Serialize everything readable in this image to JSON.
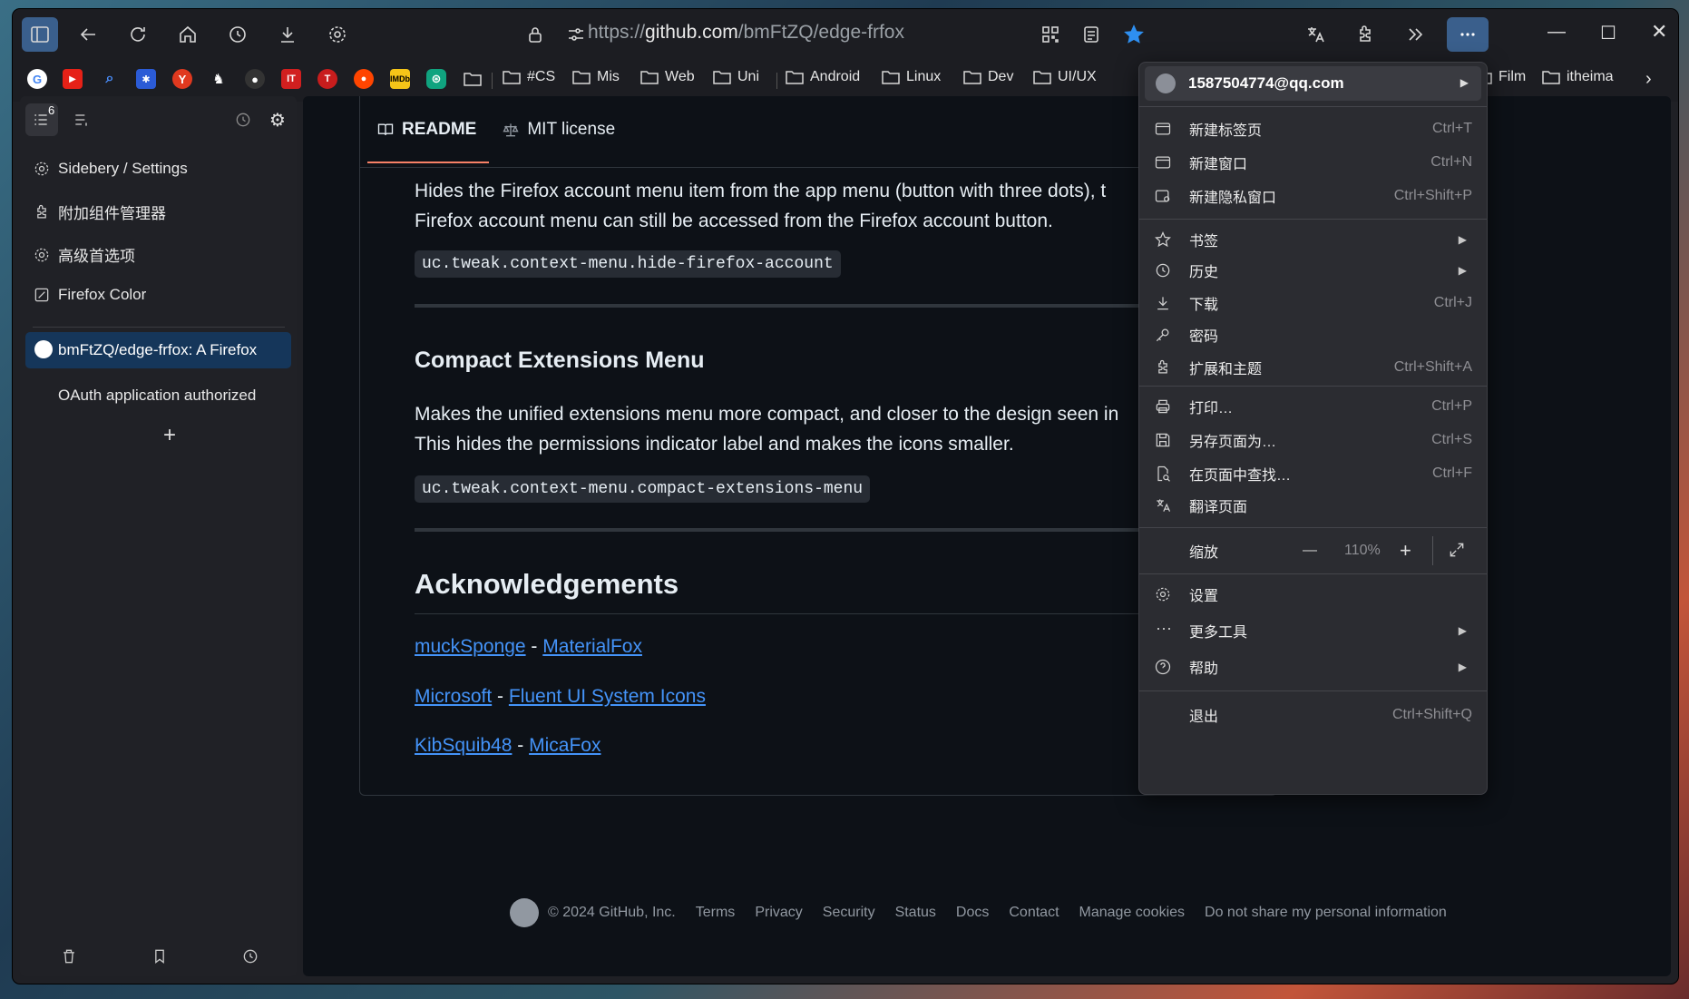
{
  "toolbar": {
    "url_prefix": "https://",
    "url_host": "github.com",
    "url_path": "/bmFtZQ/edge-frfox"
  },
  "bookmarks": {
    "folders": [
      "#CS",
      "Mis",
      "Web",
      "Uni",
      "Android",
      "Linux",
      "Dev",
      "UI/UX",
      "Film",
      "itheima"
    ],
    "icons": [
      "google-icon",
      "youtube-icon",
      "search-icon",
      "baidu-icon",
      "yandex-icon",
      "fox-icon",
      "github-icon",
      "ithome-icon",
      "t-icon",
      "reddit-icon",
      "imdb-icon",
      "chatgpt-icon"
    ]
  },
  "sidebar": {
    "tab_count": "6",
    "items": [
      "Sidebery / Settings",
      "附加组件管理器",
      "高级首选项",
      "Firefox Color"
    ],
    "active_tab": "bmFtZQ/edge-frfox: A Firefox",
    "second_tab": "OAuth application authorized",
    "add_label": "+"
  },
  "readme": {
    "tab_readme": "README",
    "tab_license": "MIT license",
    "p1_line1": "Hides the Firefox account menu item from the app menu (button with three dots), t",
    "p1_line2": "Firefox account menu can still be accessed from the Firefox account button.",
    "code1": "uc.tweak.context-menu.hide-firefox-account",
    "h_compact": "Compact Extensions Menu",
    "p2_line1": "Makes the unified extensions menu more compact, and closer to the design seen in",
    "p2_line2": "This hides the permissions indicator label and makes the icons smaller.",
    "code2": "uc.tweak.context-menu.compact-extensions-menu",
    "h_ack": "Acknowledgements",
    "ack": [
      {
        "a": "muckSponge",
        "b": "MaterialFox"
      },
      {
        "a": "Microsoft",
        "b": "Fluent UI System Icons"
      },
      {
        "a": "KibSquib48",
        "b": "MicaFox"
      }
    ],
    "dash": "-"
  },
  "footer": {
    "copyright": "© 2024 GitHub, Inc.",
    "links": [
      "Terms",
      "Privacy",
      "Security",
      "Status",
      "Docs",
      "Contact",
      "Manage cookies",
      "Do not share my personal information"
    ]
  },
  "menu": {
    "account": "1587504774@qq.com",
    "items": [
      {
        "label": "新建标签页",
        "shortcut": "Ctrl+T"
      },
      {
        "label": "新建窗口",
        "shortcut": "Ctrl+N"
      },
      {
        "label": "新建隐私窗口",
        "shortcut": "Ctrl+Shift+P"
      },
      {
        "label": "书签",
        "shortcut": ""
      },
      {
        "label": "历史",
        "shortcut": ""
      },
      {
        "label": "下载",
        "shortcut": "Ctrl+J"
      },
      {
        "label": "密码",
        "shortcut": ""
      },
      {
        "label": "扩展和主题",
        "shortcut": "Ctrl+Shift+A"
      },
      {
        "label": "打印…",
        "shortcut": "Ctrl+P"
      },
      {
        "label": "另存页面为…",
        "shortcut": "Ctrl+S"
      },
      {
        "label": "在页面中查找…",
        "shortcut": "Ctrl+F"
      },
      {
        "label": "翻译页面",
        "shortcut": ""
      },
      {
        "label": "缩放",
        "shortcut": ""
      },
      {
        "label": "设置",
        "shortcut": ""
      },
      {
        "label": "更多工具",
        "shortcut": ""
      },
      {
        "label": "帮助",
        "shortcut": ""
      },
      {
        "label": "退出",
        "shortcut": "Ctrl+Shift+Q"
      }
    ],
    "zoom_value": "110%",
    "zoom_minus": "—",
    "zoom_plus": "+"
  },
  "colors": {
    "accent": "#3a5f8c",
    "link": "#4493f8",
    "star": "#2e8ff0"
  }
}
